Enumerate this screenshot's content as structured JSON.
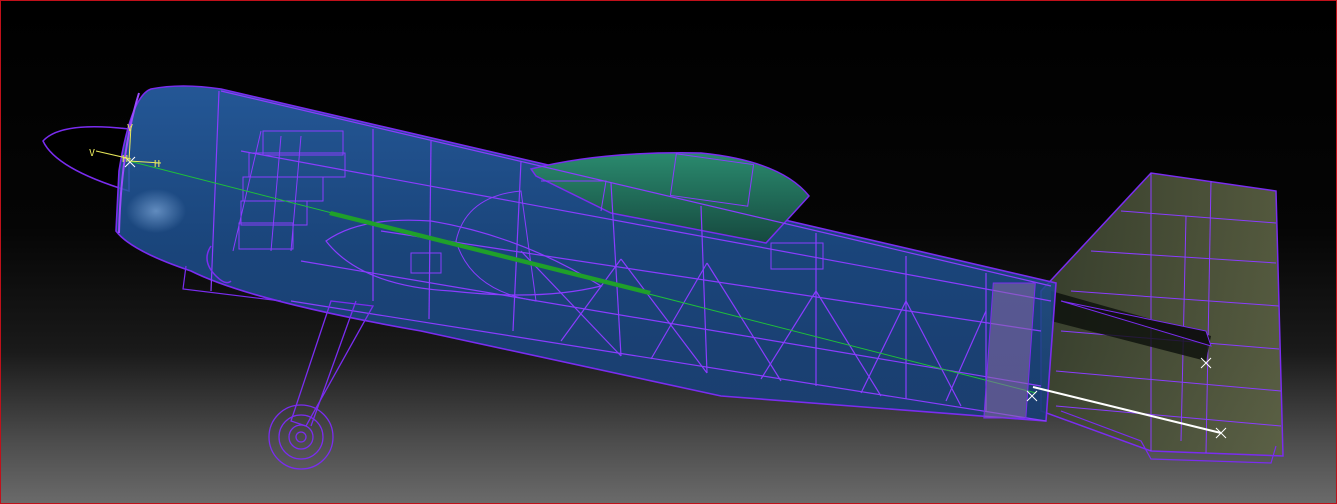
{
  "viewport": {
    "border_color": "#c0101a",
    "background_top": "#000000",
    "background_bottom": "#6a6a6a"
  },
  "model": {
    "wireframe_color": "#7a2cf0",
    "fuselage_fill": "#1f4f8f",
    "canopy_fill": "#1f6a58",
    "tail_fill": "#4f5a3a",
    "centerline_color": "#1fbf3a"
  },
  "axes": {
    "labels": [
      "V",
      "V",
      "H",
      "H"
    ],
    "color": "#e8e85a"
  }
}
